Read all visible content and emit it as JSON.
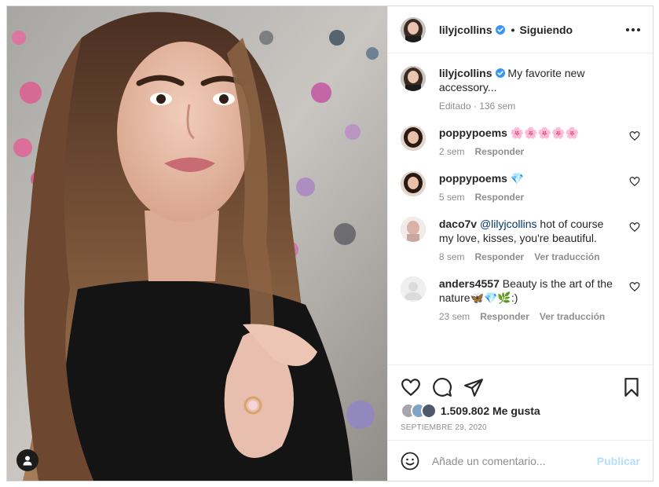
{
  "header": {
    "username": "lilyjcollins",
    "separator": "•",
    "follow_state": "Siguiendo"
  },
  "caption": {
    "username": "lilyjcollins",
    "text": "My favorite new accessory...",
    "meta": "Editado · 136 sem"
  },
  "comments": [
    {
      "username": "poppypoems",
      "text": "🌸🌸🌸🌸🌸",
      "time": "2 sem",
      "reply": "Responder",
      "translate": ""
    },
    {
      "username": "poppypoems",
      "text": "💎",
      "time": "5 sem",
      "reply": "Responder",
      "translate": ""
    },
    {
      "username": "daco7v",
      "mention": "@lilyjcollins",
      "text": "hot of course my love, kisses, you're beautiful.",
      "time": "8 sem",
      "reply": "Responder",
      "translate": "Ver traducción"
    },
    {
      "username": "anders4557",
      "text": "Beauty is the art of the nature🦋💎🌿:)",
      "time": "23 sem",
      "reply": "Responder",
      "translate": "Ver traducción"
    }
  ],
  "likes": {
    "count": "1.509.802",
    "label": "Me gusta",
    "date": "SEPTIEMBRE 29, 2020"
  },
  "add_comment": {
    "placeholder": "Añade un comentario...",
    "publish_label": "Publicar"
  },
  "icons": {
    "verified": "verified-badge-icon",
    "more": "more-options-icon",
    "like": "heart-icon",
    "comment": "comment-icon",
    "share": "paper-plane-icon",
    "save": "bookmark-icon",
    "emoji": "smiley-icon",
    "tag": "user-tag-icon"
  },
  "colors": {
    "verified_blue": "#3897f0",
    "link_blue": "#00376b",
    "publish_disabled": "#b2dffc",
    "muted_text": "#8e8e8e"
  }
}
